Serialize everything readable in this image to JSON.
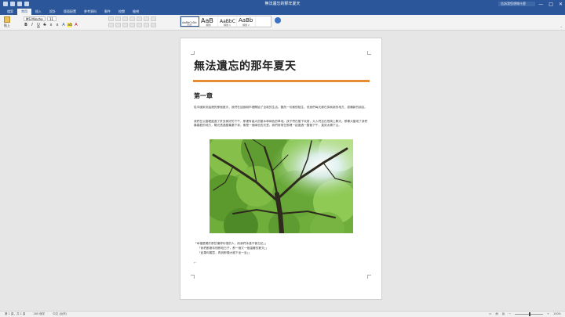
{
  "window": {
    "title": "無法遺忘的那年夏天",
    "search_placeholder": "告訴我您想做什麼",
    "controls": [
      "—",
      "□",
      "✕"
    ]
  },
  "tabs": [
    {
      "label": "檔案",
      "active": false
    },
    {
      "label": "常用",
      "active": true
    },
    {
      "label": "插入",
      "active": false
    },
    {
      "label": "設計",
      "active": false
    },
    {
      "label": "版面配置",
      "active": false
    },
    {
      "label": "參考資料",
      "active": false
    },
    {
      "label": "郵件",
      "active": false
    },
    {
      "label": "校閱",
      "active": false
    },
    {
      "label": "檢視",
      "active": false
    }
  ],
  "ribbon": {
    "paste_label": "貼上",
    "font_name": "MS Mincho",
    "font_size": "11",
    "format_buttons": [
      {
        "name": "bold-button",
        "glyph": "B"
      },
      {
        "name": "italic-button",
        "glyph": "I"
      },
      {
        "name": "underline-button",
        "glyph": "U"
      },
      {
        "name": "strikethrough-button",
        "glyph": "S"
      },
      {
        "name": "subscript-button",
        "glyph": "x"
      },
      {
        "name": "superscript-button",
        "glyph": "x"
      },
      {
        "name": "text-effects-button",
        "glyph": "A"
      },
      {
        "name": "highlight-button",
        "glyph": "ab"
      },
      {
        "name": "font-color-button",
        "glyph": "A"
      }
    ],
    "styles": [
      {
        "preview": "AaBbCcDd",
        "name": "內文"
      },
      {
        "preview": "AaB",
        "name": "標題"
      },
      {
        "preview": "AaBbC",
        "name": "標題 1"
      },
      {
        "preview": "AaBb",
        "name": "標題 2"
      }
    ]
  },
  "document": {
    "title": "無法遺忘的那年夏天",
    "chapter": "第一章",
    "paragraph1": "從中國來到這裡的那個夏天，我們在這個城市裡開始了全新的生活。雖然一切都很陌生，但我們每天都在探索新的地方，認識新的朋友。",
    "paragraph2": "我們在公園裡度過了許多美好的下午，那裡有高大的樹木和綠色的草地。孩子們在樹下玩耍，大人們坐在長椅上聊天。那棵大樹成了我們最喜歡的地方，陽光透過樹葉灑下來，像是一個綠色的天堂。我們常常在那裡一起度過一整個下午，直到太陽下山。",
    "quote1": "「幸福是屬於那些懂得珍惜的人，而我們永遠不會忘記」」",
    "quote2": "「我們都會珍惜那段日子，那一個又一個溫暖的夏天」」",
    "quote3": "「如果你願意，再到那棵大樹下坐一坐」」"
  },
  "status": {
    "page": "第 1 頁，共 1 頁",
    "words": "285 個字",
    "language": "中文 (台灣)",
    "zoom": "100%",
    "zoom_level": 0.5
  },
  "colors": {
    "accent": "#2b579a",
    "rule": "#e58c34"
  }
}
